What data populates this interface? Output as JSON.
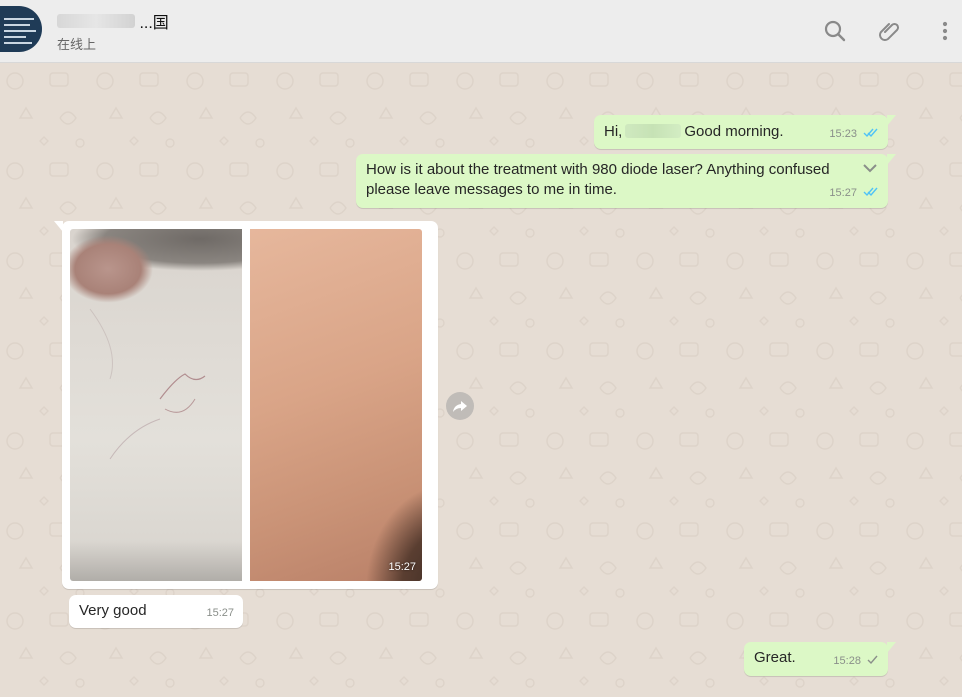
{
  "header": {
    "contact_name": "...国",
    "status": "在线上"
  },
  "messages": [
    {
      "id": "m1",
      "direction": "outgoing",
      "text_before": "Hi,",
      "text_after": "Good morning.",
      "time": "15:23",
      "ticks": "read"
    },
    {
      "id": "m2",
      "direction": "outgoing",
      "line1": "How is it about the treatment with 980 diode laser? Anything confused",
      "line2": "please leave messages to me in time.",
      "time": "15:27",
      "ticks": "read"
    },
    {
      "id": "m3",
      "direction": "incoming",
      "type": "image",
      "time": "15:27"
    },
    {
      "id": "m4",
      "direction": "incoming",
      "text": "Very good",
      "time": "15:27"
    },
    {
      "id": "m5",
      "direction": "outgoing",
      "text": "Great.",
      "time": "15:28",
      "ticks": "delivered"
    }
  ],
  "icons": {
    "search": "search-icon",
    "attach": "paperclip-icon",
    "menu": "kebab-menu-icon",
    "forward": "forward-icon",
    "message_menu": "chevron-down-icon"
  },
  "colors": {
    "outgoing_bubble": "#dcf8c6",
    "incoming_bubble": "#ffffff",
    "read_ticks": "#4fc3f7",
    "chat_background": "#e6ddd4",
    "header_background": "#ededed"
  }
}
